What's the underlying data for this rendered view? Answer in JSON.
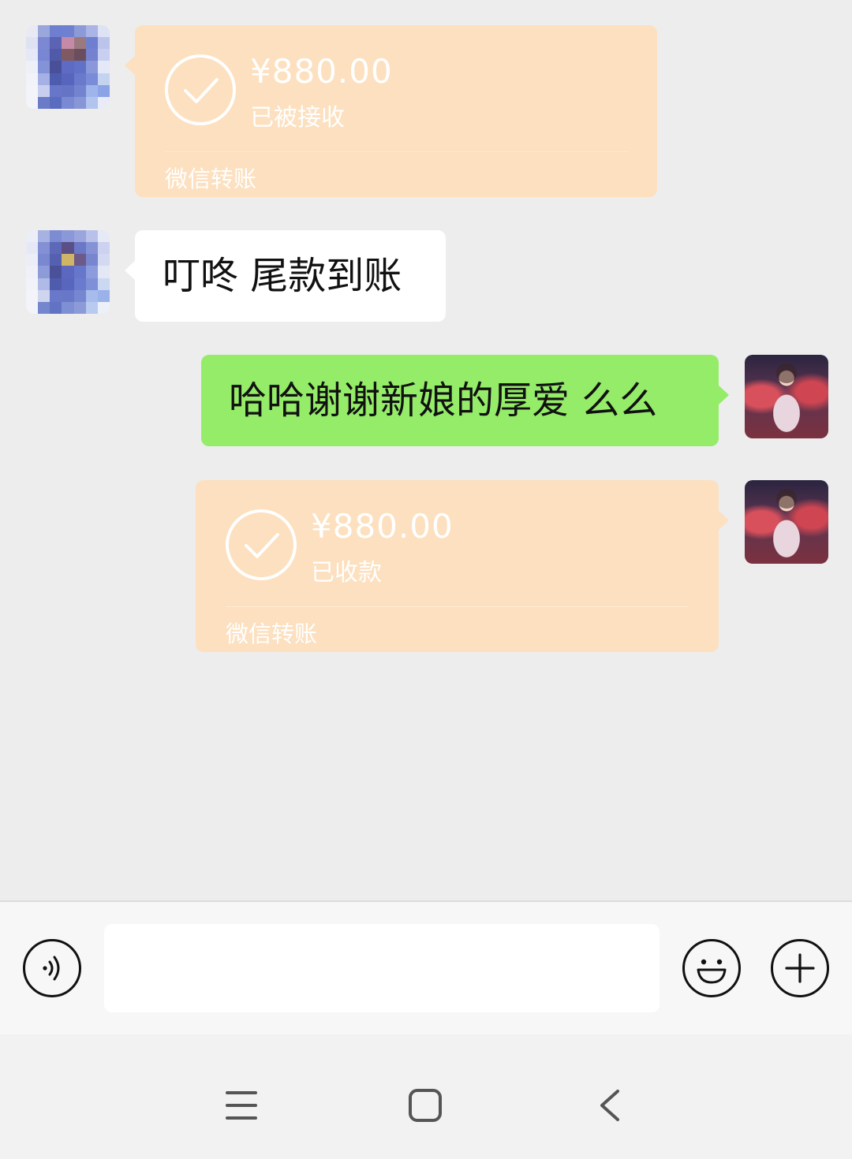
{
  "messages": [
    {
      "side": "left",
      "type": "transfer",
      "amount": "¥880.00",
      "status": "已被接收",
      "brand": "微信转账",
      "avatar": "blurred-user-avatar"
    },
    {
      "side": "left",
      "type": "text",
      "text": "叮咚 尾款到账",
      "avatar": "blurred-user-avatar"
    },
    {
      "side": "right",
      "type": "text",
      "text": "哈哈谢谢新娘的厚爱 么么",
      "avatar": "self-photo-avatar"
    },
    {
      "side": "right",
      "type": "transfer",
      "amount": "¥880.00",
      "status": "已收款",
      "brand": "微信转账",
      "avatar": "self-photo-avatar"
    }
  ],
  "input_bar": {
    "voice_icon": "voice-input-icon",
    "input_value": "",
    "emoji_icon": "emoji-icon",
    "plus_icon": "more-plus-icon"
  },
  "nav_bar": {
    "menu_icon": "menu-icon",
    "home_icon": "home-square-icon",
    "back_icon": "back-chevron-icon"
  },
  "colors": {
    "background": "#ededed",
    "transfer_bubble": "#fce0bf",
    "sent_bubble": "#95ec69",
    "received_bubble": "#ffffff"
  }
}
